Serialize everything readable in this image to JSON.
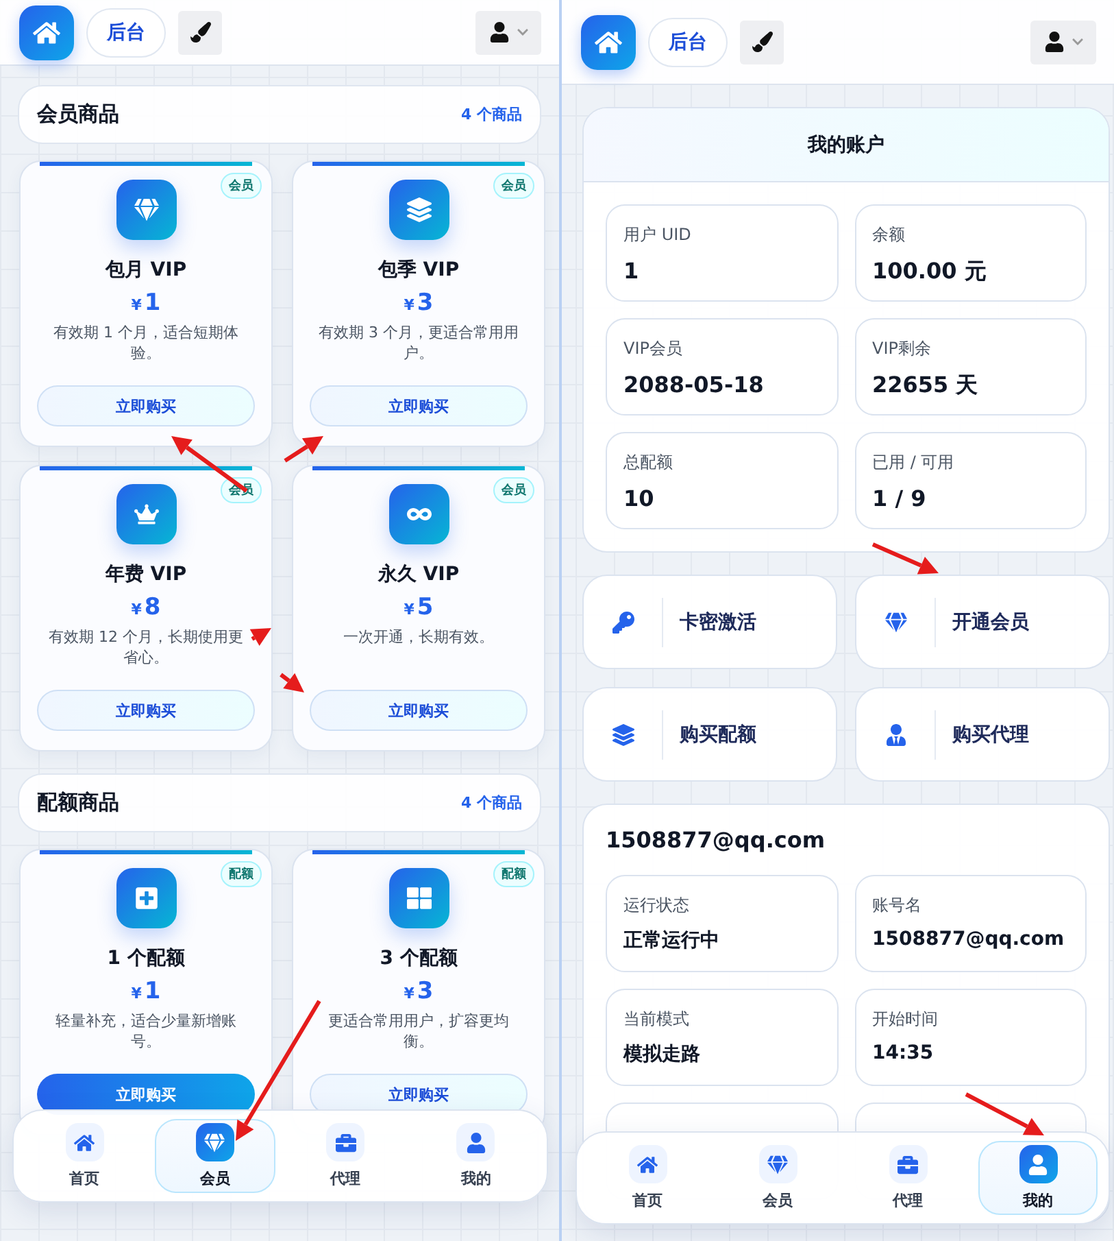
{
  "left_screen": {
    "header": {
      "admin_label": "后台"
    },
    "sections": [
      {
        "title": "会员商品",
        "count": "4 个商品",
        "products": [
          {
            "kind": "gem",
            "badge": "会员",
            "title": "包月 VIP",
            "currency": "¥",
            "price": "1",
            "description": "有效期 1 个月，适合短期体验。",
            "button": "立即购买",
            "highlighted": false
          },
          {
            "kind": "layers",
            "badge": "会员",
            "title": "包季 VIP",
            "currency": "¥",
            "price": "3",
            "description": "有效期 3 个月，更适合常用用户。",
            "button": "立即购买",
            "highlighted": false
          },
          {
            "kind": "crown",
            "badge": "会员",
            "title": "年费 VIP",
            "currency": "¥",
            "price": "8",
            "description": "有效期 12 个月，长期使用更省心。",
            "button": "立即购买",
            "highlighted": false
          },
          {
            "kind": "infinity",
            "badge": "会员",
            "title": "永久 VIP",
            "currency": "¥",
            "price": "5",
            "description": "一次开通，长期有效。",
            "button": "立即购买",
            "highlighted": false
          }
        ]
      },
      {
        "title": "配额商品",
        "count": "4 个商品",
        "products": [
          {
            "kind": "plus",
            "badge": "配额",
            "title": "1 个配额",
            "currency": "¥",
            "price": "1",
            "description": "轻量补充，适合少量新增账号。",
            "button": "立即购买",
            "highlighted": true
          },
          {
            "kind": "grid",
            "badge": "配额",
            "title": "3 个配额",
            "currency": "¥",
            "price": "3",
            "description": "更适合常用用户，扩容更均衡。",
            "button": "立即购买",
            "highlighted": false
          }
        ]
      }
    ],
    "nav": [
      {
        "kind": "home",
        "label": "首页",
        "selected": false
      },
      {
        "kind": "gem",
        "label": "会员",
        "selected": true
      },
      {
        "kind": "briefcase",
        "label": "代理",
        "selected": false
      },
      {
        "kind": "user",
        "label": "我的",
        "selected": false
      }
    ]
  },
  "right_screen": {
    "header": {
      "admin_label": "后台"
    },
    "account": {
      "title": "我的账户",
      "stats": [
        {
          "label": "用户 UID",
          "value": "1"
        },
        {
          "label": "余额",
          "value": "100.00 元"
        },
        {
          "label": "VIP会员",
          "value": "2088-05-18"
        },
        {
          "label": "VIP剩余",
          "value": "22655 天"
        },
        {
          "label": "总配额",
          "value": "10"
        },
        {
          "label": "已用 / 可用",
          "value": "1 / 9"
        }
      ]
    },
    "actions": [
      {
        "kind": "key",
        "label": "卡密激活"
      },
      {
        "kind": "gem",
        "label": "开通会员"
      },
      {
        "kind": "layers",
        "label": "购买配额"
      },
      {
        "kind": "agent",
        "label": "购买代理"
      }
    ],
    "device": {
      "title": "1508877@qq.com",
      "stats": [
        {
          "label": "运行状态",
          "value": "正常运行中"
        },
        {
          "label": "账号名",
          "value": "1508877@qq.com"
        },
        {
          "label": "当前模式",
          "value": "模拟走路"
        },
        {
          "label": "开始时间",
          "value": "14:35"
        }
      ]
    },
    "nav": [
      {
        "kind": "home",
        "label": "首页",
        "selected": false
      },
      {
        "kind": "gem",
        "label": "会员",
        "selected": false
      },
      {
        "kind": "briefcase",
        "label": "代理",
        "selected": false
      },
      {
        "kind": "user",
        "label": "我的",
        "selected": true
      }
    ]
  }
}
